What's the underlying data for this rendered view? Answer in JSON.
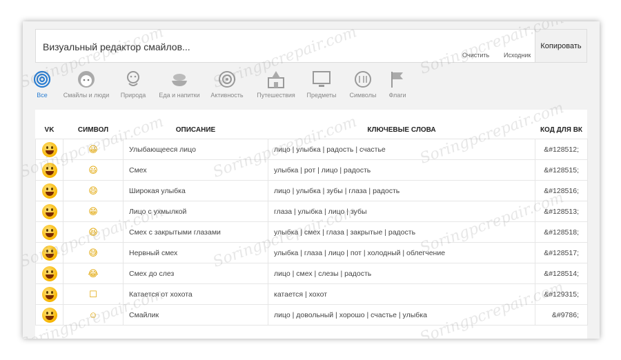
{
  "editor": {
    "placeholder": "Визуальный редактор смайлов...",
    "clear_label": "Очистить",
    "source_label": "Исходник",
    "copy_label": "Копировать"
  },
  "categories": [
    {
      "label": "Все",
      "icon": "spiral-icon"
    },
    {
      "label": "Смайлы и люди",
      "icon": "face-icon"
    },
    {
      "label": "Природа",
      "icon": "monkey-icon"
    },
    {
      "label": "Еда и напитки",
      "icon": "food-icon"
    },
    {
      "label": "Активность",
      "icon": "target-icon"
    },
    {
      "label": "Путешествия",
      "icon": "building-icon"
    },
    {
      "label": "Предметы",
      "icon": "monitor-icon"
    },
    {
      "label": "Символы",
      "icon": "eighteen-icon"
    },
    {
      "label": "Флаги",
      "icon": "flag-icon"
    }
  ],
  "columns": {
    "vk": "VK",
    "symbol": "СИМВОЛ",
    "desc": "ОПИСАНИЕ",
    "keywords": "КЛЮЧЕВЫЕ СЛОВА",
    "code": "КОД ДЛЯ ВК"
  },
  "rows": [
    {
      "desc": "Улыбающееся лицо",
      "keywords": "лицо | улыбка | радость | счастье",
      "code": "&#128512;",
      "sym": "😀"
    },
    {
      "desc": "Смех",
      "keywords": "улыбка | рот | лицо | радость",
      "code": "&#128515;",
      "sym": "😃"
    },
    {
      "desc": "Широкая улыбка",
      "keywords": "лицо | улыбка | зубы | глаза | радость",
      "code": "&#128516;",
      "sym": "😄"
    },
    {
      "desc": "Лицо с ухмылкой",
      "keywords": "глаза | улыбка | лицо | зубы",
      "code": "&#128513;",
      "sym": "😁"
    },
    {
      "desc": "Смех с закрытыми глазами",
      "keywords": "улыбка | смех | глаза | закрытые | радость",
      "code": "&#128518;",
      "sym": "😆"
    },
    {
      "desc": "Нервный смех",
      "keywords": "улыбка | глаза | лицо | пот | холодный | облегчение",
      "code": "&#128517;",
      "sym": "😅"
    },
    {
      "desc": "Смех до слез",
      "keywords": "лицо | смех | слезы | радость",
      "code": "&#128514;",
      "sym": "😂"
    },
    {
      "desc": "Катается от хохота",
      "keywords": "катается | хохот",
      "code": "&#129315;",
      "sym": "☐"
    },
    {
      "desc": "Смайлик",
      "keywords": "лицо | довольный | хорошо | счастье | улыбка",
      "code": "&#9786;",
      "sym": "☺"
    }
  ],
  "watermark": "Soringpcrepair.com",
  "colors": {
    "accent": "#2a7dd1",
    "frame_bg": "#f2f2f2",
    "emoji": "#f7b500"
  }
}
